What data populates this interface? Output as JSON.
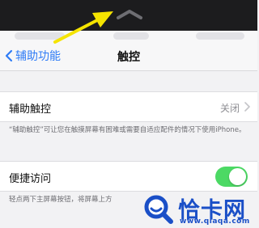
{
  "navbar": {
    "back_label": "辅助功能",
    "title": "触控"
  },
  "assistive_touch": {
    "label": "辅助触控",
    "value": "关闭",
    "note": "“辅助触控”可让您在触摸屏幕有困难或需要自适应配件的情况下使用iPhone。"
  },
  "reachability": {
    "label": "便捷访问",
    "enabled": true,
    "note": "轻点两下主屏幕按钮，将屏幕上方"
  },
  "watermark": {
    "name": "恰卡网",
    "url": "www.qiaqa.com"
  },
  "colors": {
    "accent": "#2f7cf6",
    "toggle_on": "#4cd964",
    "annotation_arrow": "#f5e400",
    "watermark": "#1a4fc7"
  },
  "icons": [
    "grabber-chevron-icon",
    "back-chevron-icon",
    "disclosure-chevron-icon",
    "annotation-arrow-icon",
    "watermark-logo-icon"
  ]
}
